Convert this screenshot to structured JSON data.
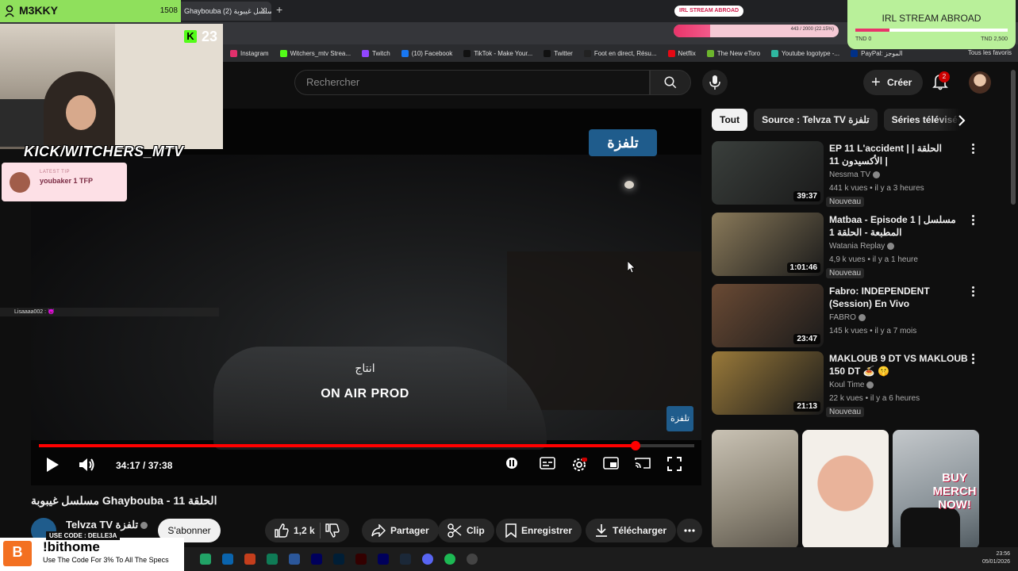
{
  "browser": {
    "tab_title": "Ghaybouba مسلسل غيبوبة (2)",
    "bookmarks": [
      {
        "label": "Instagram",
        "color": "#e1306c"
      },
      {
        "label": "Witchers_mtv Strea...",
        "color": "#53fc18"
      },
      {
        "label": "Twitch",
        "color": "#9146ff"
      },
      {
        "label": "(10) Facebook",
        "color": "#1877f2"
      },
      {
        "label": "TikTok - Make Your...",
        "color": "#111111"
      },
      {
        "label": "Twitter",
        "color": "#111111"
      },
      {
        "label": "Foot en direct, Résu...",
        "color": "#222222"
      },
      {
        "label": "Netflix",
        "color": "#e50914"
      },
      {
        "label": "The New eToro",
        "color": "#6cb52d"
      },
      {
        "label": "Youtube logotype -...",
        "color": "#2fb7a0"
      },
      {
        "label": "PayPal: الموجز",
        "color": "#003087"
      }
    ],
    "bookmarks_all": "Tous les favoris"
  },
  "youtube": {
    "search_placeholder": "Rechercher",
    "create_label": "Créer",
    "notification_count": "2"
  },
  "player": {
    "logo_text": "تلفزة",
    "credit_ar": "انتاج",
    "credit_en": "ON AIR PROD",
    "time_display": "34:17 / 37:38",
    "progress": 0.91,
    "chat_line": "Lisaaaa002 : 😈"
  },
  "video": {
    "title": "مسلسل غيبوبة Ghaybouba - 11 الحلقة",
    "channel_name": "Telvza TV تلفزة",
    "subscribe_label": "S'abonner",
    "likes": "1,2 k",
    "share_label": "Partager",
    "clip_label": "Clip",
    "save_label": "Enregistrer",
    "download_label": "Télécharger"
  },
  "chips": [
    "Tout",
    "Source : Telvza TV تلفزة",
    "Séries télévisées"
  ],
  "recommendations": [
    {
      "title": "EP 11 L'accident | الحلقة | الأكسيدون 11 |",
      "channel": "Nessma TV",
      "meta": "441 k vues • il y a 3 heures",
      "duration": "39:37",
      "badge": "Nouveau",
      "thumb_color": "#3a3f3c"
    },
    {
      "title": "Matbaa - Episode 1 | مسلسل المطبعة - الحلقة 1",
      "channel": "Watania Replay",
      "meta": "4,9 k vues • il y a 1 heure",
      "duration": "1:01:46",
      "badge": "Nouveau",
      "thumb_color": "#8a7a5a"
    },
    {
      "title": "Fabro:  INDEPENDENT (Session) En Vivo",
      "channel": "FABRO",
      "meta": "145 k vues • il y a 7 mois",
      "duration": "23:47",
      "badge": "",
      "thumb_color": "#6a4a34"
    },
    {
      "title": "MAKLOUB 9 DT VS MAKLOUB 150 DT 🍝 🤫",
      "channel": "Koul Time",
      "meta": "22 k vues • il y a 6 heures",
      "duration": "21:13",
      "badge": "Nouveau",
      "thumb_color": "#9a7a3a"
    }
  ],
  "stream_overlay": {
    "streamer_name": "M3KKY",
    "viewer_count": "1508",
    "kick_count": "23",
    "kick_handle": "KICK/WITCHERS_MTV",
    "tip_label": "LATEST TIP",
    "tip_text": "youbaker 1 TFP",
    "goal_pill": "IRL STREAM ABROAD",
    "goal_bar_text": "443 / 2000 (22.15%)",
    "goal_progress": 0.2215,
    "goal_title": "IRL STREAM ABROAD",
    "goal_min": "TND 0",
    "goal_max": "TND 2,500",
    "promo_code": "USE CODE : DELLE3A",
    "promo_cmd": "!bithome",
    "promo_text": "Use The Code For 3% To All The Specs",
    "merch_text": "BUY MERCH NOW!"
  },
  "taskbar": {
    "time": "23:56",
    "date": "05/01/2026"
  }
}
